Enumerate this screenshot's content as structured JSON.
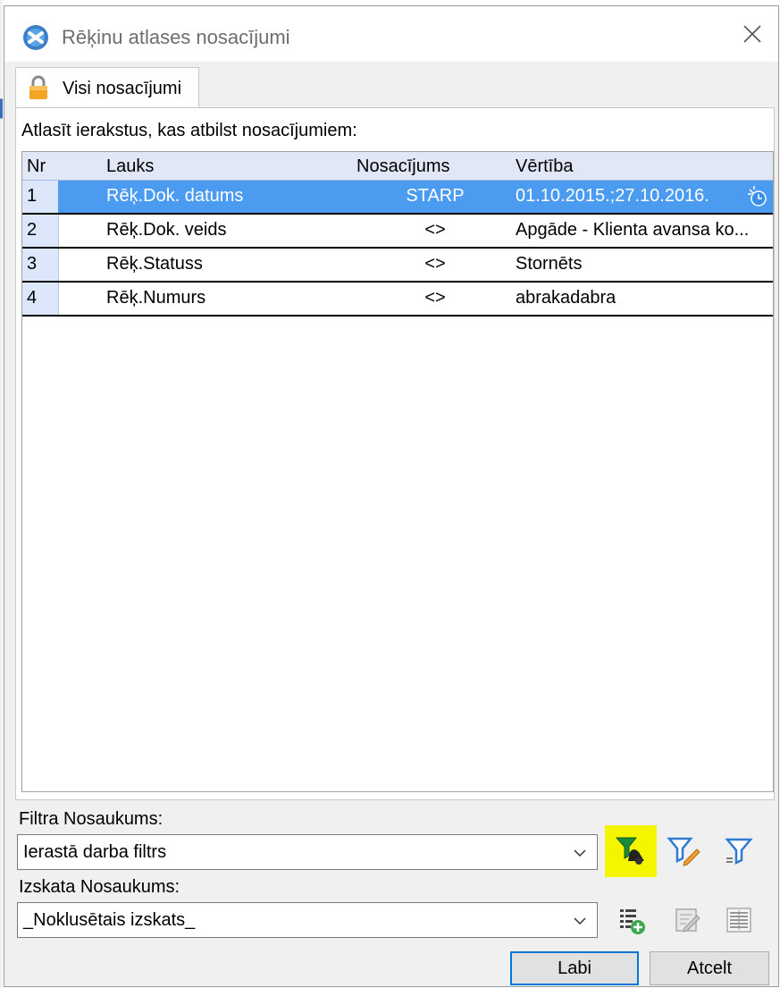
{
  "window": {
    "title": "Rēķinu atlases nosacījumi"
  },
  "tab": {
    "label": "Visi nosacījumi"
  },
  "panel": {
    "caption": "Atlasīt ierakstus, kas atbilst nosacījumiem:"
  },
  "grid": {
    "columns": {
      "nr": "Nr",
      "field": "Lauks",
      "condition": "Nosacījums",
      "value": "Vērtība"
    },
    "rows": [
      {
        "nr": "1",
        "field": "Rēķ.Dok. datums",
        "condition": "STARP",
        "value": "01.10.2015.;27.10.2016.",
        "selected": true
      },
      {
        "nr": "2",
        "field": "Rēķ.Dok. veids",
        "condition": "<>",
        "value": "Apgāde - Klienta avansa ko...",
        "selected": false
      },
      {
        "nr": "3",
        "field": "Rēķ.Statuss",
        "condition": "<>",
        "value": "Stornēts",
        "selected": false
      },
      {
        "nr": "4",
        "field": "Rēķ.Numurs",
        "condition": "<>",
        "value": "abrakadabra",
        "selected": false
      }
    ],
    "selected_color": "#4b9bf0"
  },
  "filter": {
    "label": "Filtra Nosaukums:",
    "value": "Ierastā darba filtrs",
    "icons": [
      "clear-filter-icon",
      "edit-filter-icon",
      "filter-icon"
    ],
    "highlight_color": "#f5f500"
  },
  "view": {
    "label": "Izskata Nosaukums:",
    "value": "_Noklusētais izskats_",
    "icons": [
      "add-view-icon",
      "edit-view-icon",
      "columns-view-icon"
    ]
  },
  "buttons": {
    "ok": "Labi",
    "cancel": "Atcelt"
  }
}
